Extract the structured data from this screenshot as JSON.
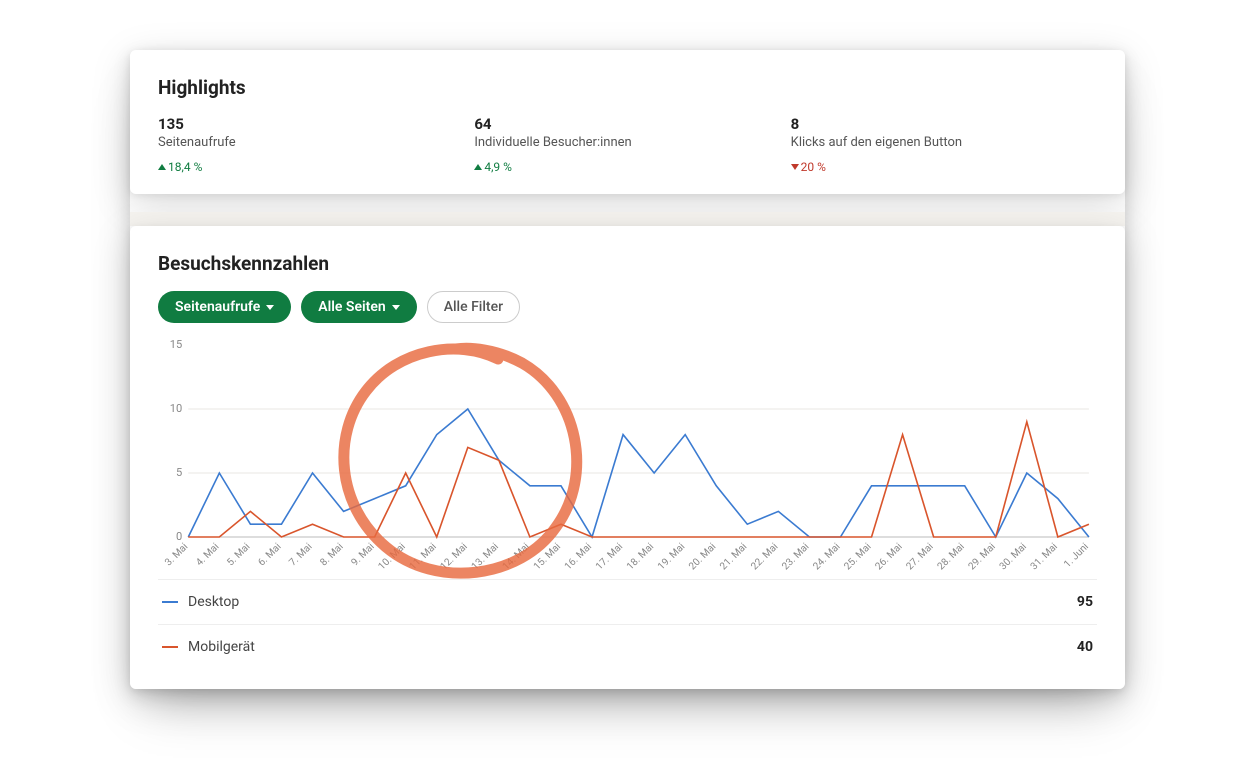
{
  "highlights": {
    "title": "Highlights",
    "items": [
      {
        "value": "135",
        "label": "Seitenaufrufe",
        "change": "18,4 %",
        "dir": "up"
      },
      {
        "value": "64",
        "label": "Individuelle Besucher:innen",
        "change": "4,9 %",
        "dir": "up"
      },
      {
        "value": "8",
        "label": "Klicks auf den eigenen Button",
        "change": "20 %",
        "dir": "down"
      }
    ]
  },
  "metrics": {
    "title": "Besuchskennzahlen",
    "filters": {
      "metric": "Seitenaufrufe",
      "pages": "Alle Seiten",
      "all": "Alle Filter"
    }
  },
  "legend": {
    "desktop": {
      "name": "Desktop",
      "total": "95"
    },
    "mobile": {
      "name": "Mobilgerät",
      "total": "40"
    }
  },
  "chart_data": {
    "type": "line",
    "title": "Besuchskennzahlen",
    "xlabel": "",
    "ylabel": "",
    "ylim": [
      0,
      15
    ],
    "yticks": [
      0,
      5,
      10,
      15
    ],
    "categories": [
      "3. Mai",
      "4. Mai",
      "5. Mai",
      "6. Mai",
      "7. Mai",
      "8. Mai",
      "9. Mai",
      "10. Mai",
      "11. Mai",
      "12. Mai",
      "13. Mai",
      "14. Mai",
      "15. Mai",
      "16. Mai",
      "17. Mai",
      "18. Mai",
      "19. Mai",
      "20. Mai",
      "21. Mai",
      "22. Mai",
      "23. Mai",
      "24. Mai",
      "25. Mai",
      "26. Mai",
      "27. Mai",
      "28. Mai",
      "29. Mai",
      "30. Mai",
      "31. Mai",
      "1. Juni"
    ],
    "series": [
      {
        "name": "Desktop",
        "color": "#3b7bd1",
        "total": 95,
        "values": [
          0,
          5,
          1,
          1,
          5,
          2,
          3,
          4,
          8,
          10,
          6,
          4,
          4,
          0,
          8,
          5,
          8,
          4,
          1,
          2,
          0,
          0,
          4,
          4,
          4,
          4,
          0,
          5,
          3,
          0
        ]
      },
      {
        "name": "Mobilgerät",
        "color": "#d9552c",
        "total": 40,
        "values": [
          0,
          0,
          2,
          0,
          1,
          0,
          0,
          5,
          0,
          7,
          6,
          0,
          1,
          0,
          0,
          0,
          0,
          0,
          0,
          0,
          0,
          0,
          0,
          8,
          0,
          0,
          0,
          9,
          0,
          1
        ]
      }
    ]
  }
}
